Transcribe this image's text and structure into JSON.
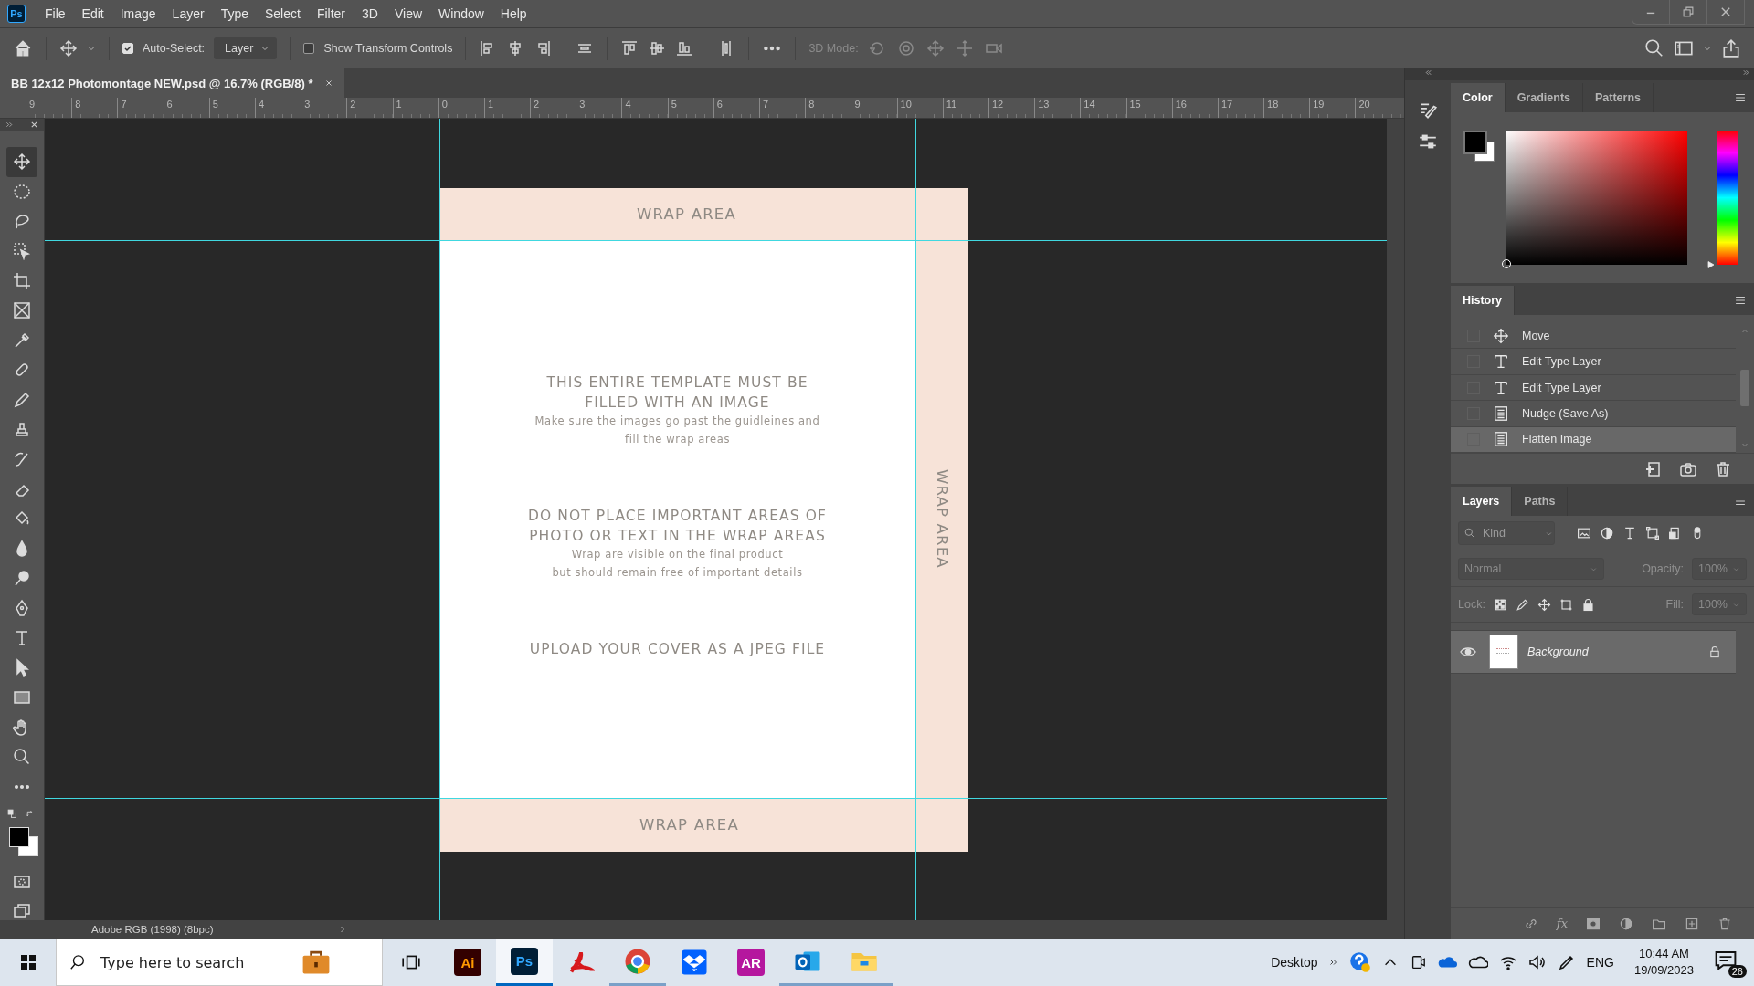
{
  "menu_bar": {
    "logo": "Ps",
    "items": [
      "File",
      "Edit",
      "Image",
      "Layer",
      "Type",
      "Select",
      "Filter",
      "3D",
      "View",
      "Window",
      "Help"
    ]
  },
  "options_bar": {
    "auto_select": {
      "label": "Auto-Select:",
      "checked": true
    },
    "target": "Layer",
    "transform_controls": {
      "label": "Show Transform Controls",
      "checked": false
    },
    "mode_label": "3D Mode:"
  },
  "document_tab": {
    "title": "BB 12x12 Photomontage NEW.psd @ 16.7% (RGB/8) *"
  },
  "ruler": {
    "labels": [
      "9",
      "8",
      "7",
      "6",
      "5",
      "4",
      "3",
      "2",
      "1",
      "0",
      "1",
      "2",
      "3",
      "4",
      "5",
      "6",
      "7",
      "8",
      "9",
      "10",
      "11",
      "12",
      "13",
      "14",
      "15",
      "16",
      "17",
      "18",
      "19",
      "20"
    ]
  },
  "tools": [
    {
      "kind": "move",
      "selected": true
    },
    {
      "kind": "ellipse-marquee",
      "selected": false
    },
    {
      "kind": "lasso",
      "selected": false
    },
    {
      "kind": "object-select",
      "selected": false
    },
    {
      "kind": "crop",
      "selected": false
    },
    {
      "kind": "frame",
      "selected": false
    },
    {
      "kind": "eyedropper",
      "selected": false
    },
    {
      "kind": "healing",
      "selected": false
    },
    {
      "kind": "pencil",
      "selected": false
    },
    {
      "kind": "stamp",
      "selected": false
    },
    {
      "kind": "history-brush",
      "selected": false
    },
    {
      "kind": "eraser",
      "selected": false
    },
    {
      "kind": "bucket",
      "selected": false
    },
    {
      "kind": "blur",
      "selected": false
    },
    {
      "kind": "dodge",
      "selected": false
    },
    {
      "kind": "pen",
      "selected": false
    },
    {
      "kind": "type",
      "selected": false
    },
    {
      "kind": "path-select",
      "selected": false
    },
    {
      "kind": "rectangle",
      "selected": false
    },
    {
      "kind": "hand",
      "selected": false
    },
    {
      "kind": "zoom",
      "selected": false
    },
    {
      "kind": "more",
      "selected": false
    }
  ],
  "document": {
    "wrap_top": "WRAP AREA",
    "wrap_side": "WRAP AREA",
    "wrap_bottom": "WRAP AREA",
    "blocks": [
      {
        "heading": [
          "THIS ENTIRE TEMPLATE MUST BE",
          "FILLED WITH AN IMAGE"
        ],
        "note": [
          "Make sure the images go past the guidleines and",
          "fill the wrap areas"
        ]
      },
      {
        "heading": [
          "DO NOT PLACE IMPORTANT AREAS OF",
          "PHOTO OR TEXT IN THE WRAP AREAS"
        ],
        "note": [
          "Wrap are visible on the final product",
          "but should remain free of important details"
        ]
      },
      {
        "heading": [
          "UPLOAD YOUR COVER AS A JPEG FILE"
        ]
      }
    ]
  },
  "status_bar": {
    "profile": "Adobe RGB (1998) (8bpc)"
  },
  "color_panel": {
    "tabs": [
      {
        "label": "Color",
        "selected": true
      },
      {
        "label": "Gradients",
        "selected": false
      },
      {
        "label": "Patterns",
        "selected": false
      }
    ],
    "hue": {
      "level": 0
    }
  },
  "history_panel": {
    "tabs": [
      {
        "label": "History",
        "selected": true
      }
    ],
    "items": [
      {
        "label": "Move",
        "kind": "move",
        "selected": false
      },
      {
        "label": "Edit Type Layer",
        "kind": "type",
        "selected": false
      },
      {
        "label": "Edit Type Layer",
        "kind": "type",
        "selected": false
      },
      {
        "label": "Nudge (Save As)",
        "kind": "document",
        "selected": false
      },
      {
        "label": "Flatten Image",
        "kind": "document",
        "selected": true
      }
    ]
  },
  "layers_panel": {
    "tabs": [
      {
        "label": "Layers",
        "selected": true
      },
      {
        "label": "Paths",
        "selected": false
      }
    ],
    "filter": {
      "placeholder": "Kind"
    },
    "blend_mode": {
      "value": "Normal",
      "disabled": true
    },
    "opacity": {
      "label": "Opacity:",
      "value": "100%",
      "disabled": true
    },
    "lock_label": "Lock:",
    "fill": {
      "label": "Fill:",
      "value": "100%",
      "disabled": true
    },
    "layers": [
      {
        "name": "Background",
        "visible": true,
        "locked": true,
        "selected": true
      }
    ],
    "fx": "fx"
  },
  "taskbar": {
    "search": {
      "placeholder": "Type here to search"
    },
    "apps": [
      {
        "kind": "illustrator",
        "label": "Ai",
        "running": false,
        "selected": false
      },
      {
        "kind": "photoshop",
        "label": "Ps",
        "running": true,
        "selected": true
      },
      {
        "kind": "acrobat",
        "running": false,
        "selected": false
      },
      {
        "kind": "chrome",
        "running": true,
        "selected": false
      },
      {
        "kind": "dropbox",
        "running": false,
        "selected": false
      },
      {
        "kind": "ar",
        "label": "AR",
        "running": false,
        "selected": false
      },
      {
        "kind": "outlook",
        "running": true,
        "selected": false
      },
      {
        "kind": "explorer",
        "running": true,
        "selected": false
      }
    ],
    "desktop": "Desktop",
    "language": "ENG",
    "time": "10:44 AM",
    "date": "19/09/2023",
    "notifications": "26"
  }
}
